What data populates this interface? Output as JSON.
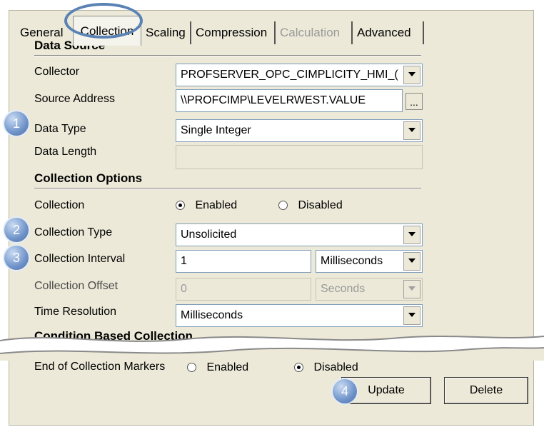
{
  "tabs": [
    {
      "label": "General",
      "state": "normal"
    },
    {
      "label": "Collection",
      "state": "active"
    },
    {
      "label": "Scaling",
      "state": "normal"
    },
    {
      "label": "Compression",
      "state": "normal"
    },
    {
      "label": "Calculation",
      "state": "disabled"
    },
    {
      "label": "Advanced",
      "state": "normal"
    }
  ],
  "data_source": {
    "header": "Data Source",
    "collector_label": "Collector",
    "collector_value": "PROFSERVER_OPC_CIMPLICITY_HMI_(",
    "source_address_label": "Source Address",
    "source_address_value": "\\\\PROFCIMP\\LEVELRWEST.VALUE",
    "browse_label": "...",
    "data_type_label": "Data Type",
    "data_type_value": "Single Integer",
    "data_length_label": "Data Length",
    "data_length_value": ""
  },
  "collection_options": {
    "header": "Collection Options",
    "collection_label": "Collection",
    "enabled_label": "Enabled",
    "disabled_label": "Disabled",
    "collection_selected": "Enabled",
    "collection_type_label": "Collection Type",
    "collection_type_value": "Unsolicited",
    "collection_interval_label": "Collection Interval",
    "collection_interval_value": "1",
    "collection_interval_unit": "Milliseconds",
    "collection_offset_label": "Collection Offset",
    "collection_offset_value": "0",
    "collection_offset_unit": "Seconds",
    "time_resolution_label": "Time Resolution",
    "time_resolution_value": "Milliseconds"
  },
  "condition_header": "Condition Based Collection",
  "end_markers": {
    "label": "End of Collection Markers",
    "enabled_label": "Enabled",
    "disabled_label": "Disabled",
    "selected": "Disabled"
  },
  "buttons": {
    "update": "Update",
    "delete": "Delete"
  },
  "callouts": [
    "1",
    "2",
    "3",
    "4"
  ],
  "colors": {
    "panel": "#ece9d8",
    "callout": "#6f93c9",
    "tab_highlight": "#5b82b5"
  }
}
